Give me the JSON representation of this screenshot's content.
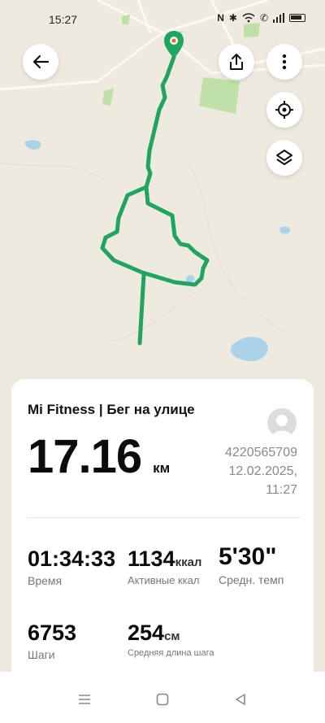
{
  "status_bar": {
    "time": "15:27",
    "icons": [
      "nfc-icon",
      "bluetooth-icon",
      "wifi-icon",
      "call-icon",
      "signal-icon",
      "battery-icon"
    ]
  },
  "map": {
    "route_color": "#1fa560",
    "water_color": "#a9d3e8",
    "park_color": "#bfe0a6",
    "marker_color": "#1fa560"
  },
  "header": {
    "back_icon": "arrow-left-icon",
    "share_icon": "share-icon",
    "more_icon": "more-vertical-icon",
    "locate_icon": "locate-icon",
    "layers_icon": "layers-icon"
  },
  "workout": {
    "title": "Mi Fitness | Бег на улице",
    "distance_value": "17.16",
    "distance_unit": "км",
    "device_id": "4220565709",
    "date": "12.02.2025,",
    "time": "11:27"
  },
  "metrics": {
    "duration": {
      "value": "01:34:33",
      "label": "Время"
    },
    "calories": {
      "value": "1134",
      "unit": "ккал",
      "label": "Активные ккал"
    },
    "pace": {
      "value": "5'30\"",
      "label": "Средн. темп"
    },
    "steps": {
      "value": "6753",
      "label": "Шаги"
    },
    "stride": {
      "value": "254",
      "unit": "см",
      "label": "Средняя длина шага"
    }
  },
  "nav": {
    "menu_icon": "menu-icon",
    "home_icon": "home-icon",
    "back_icon": "back-triangle-icon"
  }
}
